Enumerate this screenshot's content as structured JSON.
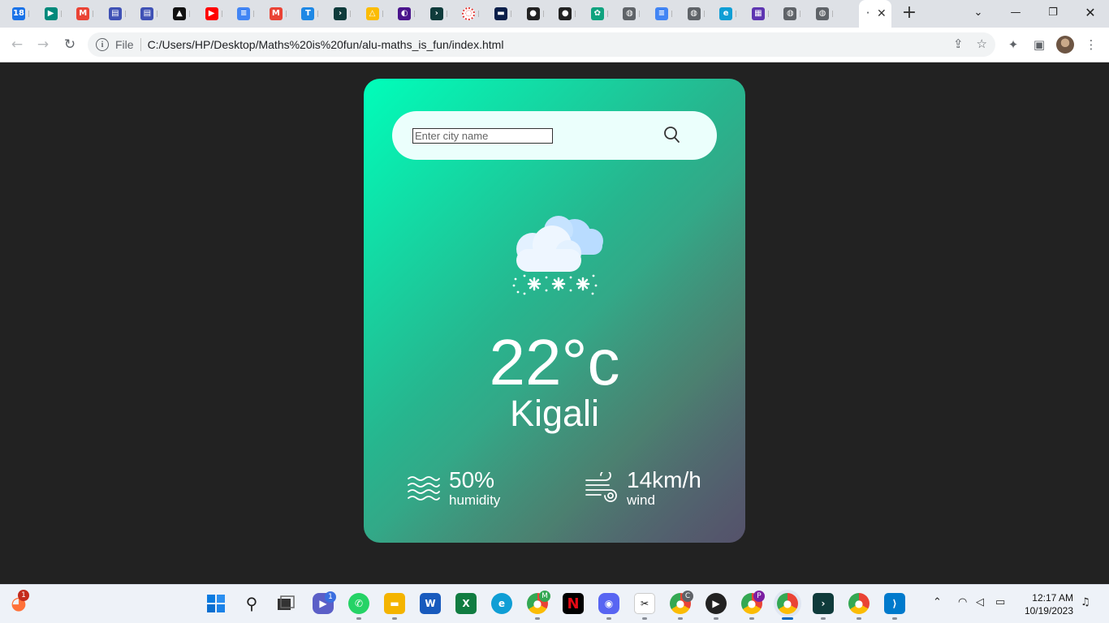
{
  "browser": {
    "tabs": [
      {
        "icon": "calendar-icon",
        "glyph": "18",
        "color": "#1a73e8"
      },
      {
        "icon": "google-meet-icon",
        "glyph": "▶",
        "color": "#00897b"
      },
      {
        "icon": "gmail-icon",
        "glyph": "M",
        "color": "#ea4335"
      },
      {
        "icon": "forms-icon",
        "glyph": "▤",
        "color": "#3f51b5"
      },
      {
        "icon": "forms-icon",
        "glyph": "▤",
        "color": "#3f51b5"
      },
      {
        "icon": "vercel-icon",
        "glyph": "▲",
        "color": "#111111"
      },
      {
        "icon": "youtube-icon",
        "glyph": "▶",
        "color": "#ff0000"
      },
      {
        "icon": "docs-icon",
        "glyph": "≡",
        "color": "#4285f4"
      },
      {
        "icon": "gmail-icon",
        "glyph": "M",
        "color": "#ea4335"
      },
      {
        "icon": "tab-t-icon",
        "glyph": "T",
        "color": "#1e88e5"
      },
      {
        "icon": "app-icon",
        "glyph": "›",
        "color": "#0f3b3b"
      },
      {
        "icon": "drive-icon",
        "glyph": "△",
        "color": "#fbbc04"
      },
      {
        "icon": "app-icon",
        "glyph": "◐",
        "color": "#4a148c"
      },
      {
        "icon": "app-icon",
        "glyph": "›",
        "color": "#0f3b3b"
      },
      {
        "icon": "loading-icon",
        "glyph": "◌",
        "color": "#ffffff"
      },
      {
        "icon": "app-icon",
        "glyph": "▬",
        "color": "#0b1f4a"
      },
      {
        "icon": "github-icon",
        "glyph": "●",
        "color": "#222222"
      },
      {
        "icon": "github-icon",
        "glyph": "●",
        "color": "#222222"
      },
      {
        "icon": "openai-icon",
        "glyph": "✿",
        "color": "#10a37f"
      },
      {
        "icon": "globe-icon",
        "glyph": "◍",
        "color": "#5f6368"
      },
      {
        "icon": "docs-icon",
        "glyph": "≡",
        "color": "#4285f4"
      },
      {
        "icon": "globe-icon",
        "glyph": "◍",
        "color": "#5f6368"
      },
      {
        "icon": "edge-icon",
        "glyph": "e",
        "color": "#0f9ed5"
      },
      {
        "icon": "app-icon",
        "glyph": "▦",
        "color": "#5e35b1"
      },
      {
        "icon": "globe-icon",
        "glyph": "◍",
        "color": "#5f6368"
      },
      {
        "icon": "globe-icon",
        "glyph": "◍",
        "color": "#5f6368"
      }
    ],
    "active_tab_close": "✕",
    "url_scheme": "File",
    "url": "C:/Users/HP/Desktop/Maths%20is%20fun/alu-maths_is_fun/index.html"
  },
  "app": {
    "search": {
      "placeholder": "Enter city name",
      "value": ""
    },
    "weather": {
      "condition_icon": "snow-cloud-icon"
    },
    "temperature": "22°c",
    "city": "Kigali",
    "humidity": {
      "value": "50%",
      "label": "humidity"
    },
    "wind": {
      "value": "14km/h",
      "label": "wind"
    }
  },
  "taskbar": {
    "firefox_badge": "1",
    "zoom_badge": "1",
    "chrome_profile_labels": [
      "M",
      "C",
      "P"
    ],
    "time": "12:17 AM",
    "date": "10/19/2023"
  },
  "colors": {
    "card_gradient_start": "#00feba",
    "card_gradient_end": "#5b548a",
    "page_background": "#222222",
    "search_background": "#ebfffc"
  }
}
